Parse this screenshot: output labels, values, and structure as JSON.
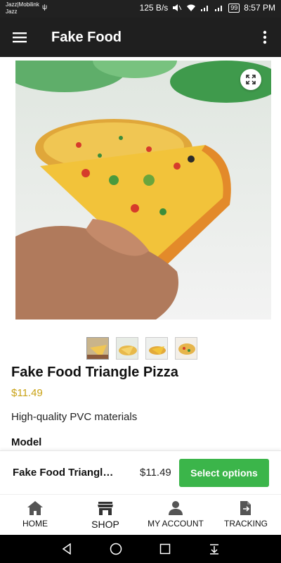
{
  "status_bar": {
    "carrier_line1": "Jazz|Mobilink",
    "carrier_line2": "Jazz",
    "speed": "125 B/s",
    "battery": "99",
    "time": "8:57 PM"
  },
  "app_bar": {
    "title": "Fake Food"
  },
  "product": {
    "title": "Fake Food Triangle Pizza",
    "price": "$11.49",
    "description": "High-quality PVC materials",
    "model_label": "Model",
    "thumbnail_count": 4
  },
  "sticky_bar": {
    "name": "Fake Food Triangle Pizza",
    "price": "$11.49",
    "button_label": "Select options",
    "button_color": "#3bb54a"
  },
  "bottom_nav": {
    "items": [
      {
        "label": "HOME",
        "icon": "home-icon"
      },
      {
        "label": "SHOP",
        "icon": "shop-icon"
      },
      {
        "label": "MY ACCOUNT",
        "icon": "account-icon"
      },
      {
        "label": "TRACKING",
        "icon": "tracking-icon"
      }
    ]
  },
  "colors": {
    "price": "#c9a215",
    "app_bar": "#1f1f1f"
  }
}
